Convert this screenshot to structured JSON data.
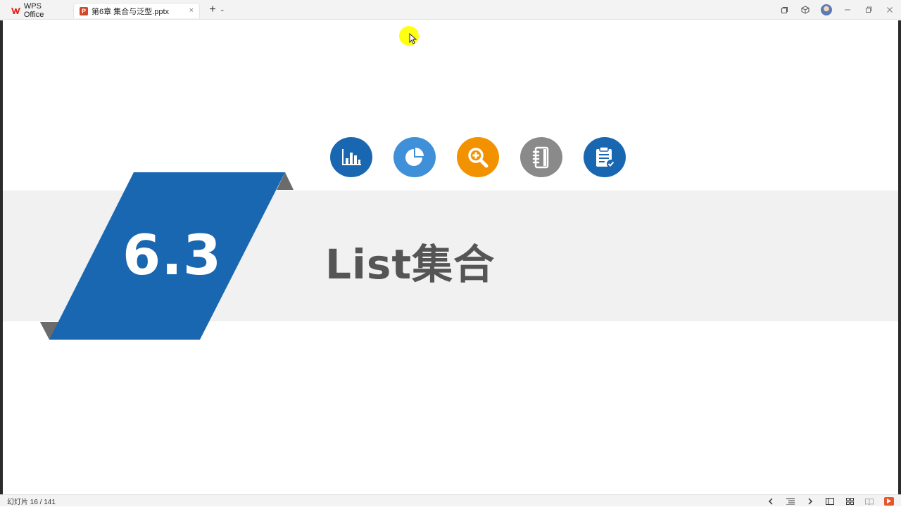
{
  "tabs": {
    "home_label": "WPS Office",
    "doc_label": "第6章 集合与泛型.pptx",
    "doc_badge": "P",
    "close_symbol": "×",
    "add_symbol": "+",
    "dropdown_symbol": "⌄"
  },
  "slide": {
    "section_number": "6.3",
    "section_title": "List集合",
    "icons": [
      {
        "name": "bar-chart-icon",
        "color": "#1a67b1"
      },
      {
        "name": "pie-chart-icon",
        "color": "#3f8fd9"
      },
      {
        "name": "zoom-in-icon",
        "color": "#f39200"
      },
      {
        "name": "notebook-icon",
        "color": "#8a8a8a"
      },
      {
        "name": "checklist-icon",
        "color": "#1a67b1"
      }
    ],
    "colors": {
      "parallelogram": "#1a67b1",
      "band": "#f1f1f2",
      "title_text": "#555555",
      "fold": "#6b6b6b"
    }
  },
  "status": {
    "slide_counter": "幻灯片 16 / 141"
  }
}
